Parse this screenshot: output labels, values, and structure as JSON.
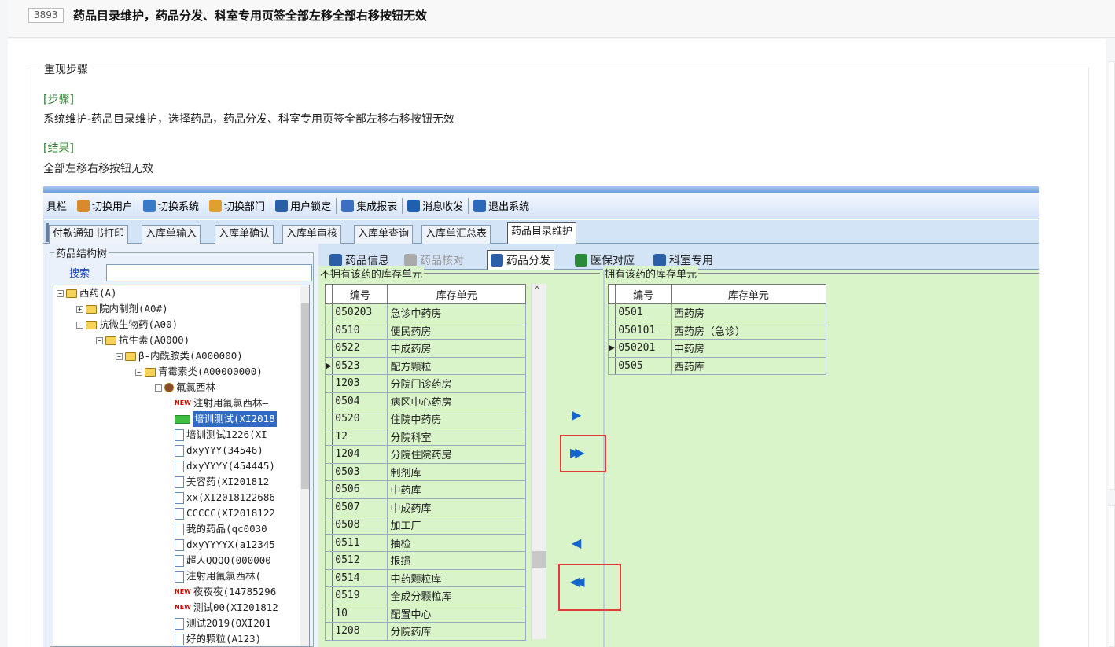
{
  "issue": {
    "id": "3893",
    "title": "药品目录维护，药品分发、科室专用页签全部左移全部右移按钮无效"
  },
  "section": {
    "legend": "重现步骤",
    "steps_label": "[步骤]",
    "steps_text": "系统维护-药品目录维护，选择药品，药品分发、科室专用页签全部左移右移按钮无效",
    "result_label": "[结果]",
    "result_text": "全部左移右移按钮无效"
  },
  "toolbar": {
    "items": [
      {
        "label": "具栏",
        "icon": "none"
      },
      {
        "label": "切换用户",
        "icon": "users-icon"
      },
      {
        "label": "切换系统",
        "icon": "switch-system-icon"
      },
      {
        "label": "切换部门",
        "icon": "department-icon"
      },
      {
        "label": "用户锁定",
        "icon": "user-lock-icon"
      },
      {
        "label": "集成报表",
        "icon": "report-icon"
      },
      {
        "label": "消息收发",
        "icon": "info-icon"
      },
      {
        "label": "退出系统",
        "icon": "exit-icon"
      }
    ]
  },
  "tabs": [
    "付款通知书打印",
    "入库单输入",
    "入库单确认",
    "入库单审核",
    "入库单查询",
    "入库单汇总表",
    "药品目录维护"
  ],
  "tree": {
    "legend": "药品结构树",
    "search_label": "搜索",
    "nodes": [
      {
        "label": "西药(A)",
        "indent": 0,
        "type": "folder",
        "exp": "-"
      },
      {
        "label": "院内制剂(A0#)",
        "indent": 1,
        "type": "folder",
        "exp": "+"
      },
      {
        "label": "抗微生物药(A00)",
        "indent": 1,
        "type": "folder",
        "exp": "-"
      },
      {
        "label": "抗生素(A0000)",
        "indent": 2,
        "type": "folder",
        "exp": "-"
      },
      {
        "label": "β-内酰胺类(A000000)",
        "indent": 3,
        "type": "folder",
        "exp": "-"
      },
      {
        "label": "青霉素类(A00000000)",
        "indent": 4,
        "type": "folder",
        "exp": "-"
      },
      {
        "label": "氟氯西林",
        "indent": 5,
        "type": "drug",
        "exp": "-"
      },
      {
        "label": "注射用氟氯西林—",
        "indent": 6,
        "type": "new"
      },
      {
        "label": "培训测试(XI2018",
        "indent": 6,
        "type": "selected"
      },
      {
        "label": "培训测试1226(XI",
        "indent": 6,
        "type": "doc"
      },
      {
        "label": "dxyYYY(34546)",
        "indent": 6,
        "type": "doc"
      },
      {
        "label": "dxyYYYY(454445)",
        "indent": 6,
        "type": "doc"
      },
      {
        "label": "美容药(XI201812",
        "indent": 6,
        "type": "doc"
      },
      {
        "label": "xx(XI2018122686",
        "indent": 6,
        "type": "doc"
      },
      {
        "label": "CCCCC(XI2018122",
        "indent": 6,
        "type": "doc"
      },
      {
        "label": "我的药品(qc0030",
        "indent": 6,
        "type": "doc"
      },
      {
        "label": "dxyYYYYX(a12345",
        "indent": 6,
        "type": "doc"
      },
      {
        "label": "超人QQQQ(000000",
        "indent": 6,
        "type": "doc"
      },
      {
        "label": "注射用氟氯西林(",
        "indent": 6,
        "type": "doc"
      },
      {
        "label": "夜夜夜(14785296",
        "indent": 6,
        "type": "new"
      },
      {
        "label": "测试00(XI201812",
        "indent": 6,
        "type": "new"
      },
      {
        "label": "测试2019(OXI201",
        "indent": 6,
        "type": "doc"
      },
      {
        "label": "好的颗粒(A123)",
        "indent": 6,
        "type": "doc"
      }
    ]
  },
  "subtabs": [
    {
      "label": "药品信息",
      "state": "normal"
    },
    {
      "label": "药品核对",
      "state": "disabled"
    },
    {
      "label": "药品分发",
      "state": "active"
    },
    {
      "label": "医保对应",
      "state": "normal"
    },
    {
      "label": "科室专用",
      "state": "normal"
    }
  ],
  "left_group": {
    "title": "不拥有该药的库存单元",
    "headers": [
      "编号",
      "库存单元"
    ],
    "current_row": 3,
    "rows": [
      [
        "050203",
        "急诊中药房"
      ],
      [
        "0510",
        "便民药房"
      ],
      [
        "0522",
        "中成药房"
      ],
      [
        "0523",
        "配方颗粒"
      ],
      [
        "1203",
        "分院门诊药房"
      ],
      [
        "0504",
        "病区中心药房"
      ],
      [
        "0520",
        "住院中药房"
      ],
      [
        "12",
        "分院科室"
      ],
      [
        "1204",
        "分院住院药房"
      ],
      [
        "0503",
        "制剂库"
      ],
      [
        "0506",
        "中药库"
      ],
      [
        "0507",
        "中成药库"
      ],
      [
        "0508",
        "加工厂"
      ],
      [
        "0511",
        "抽检"
      ],
      [
        "0512",
        "报损"
      ],
      [
        "0514",
        "中药颗粒库"
      ],
      [
        "0519",
        "全成分颗粒库"
      ],
      [
        "10",
        "配置中心"
      ],
      [
        "1208",
        "分院药库"
      ]
    ]
  },
  "right_group": {
    "title": "拥有该药的库存单元",
    "headers": [
      "编号",
      "库存单元"
    ],
    "current_row": 2,
    "rows": [
      [
        "0501",
        "西药房"
      ],
      [
        "050101",
        "西药房（急诊）"
      ],
      [
        "050201",
        "中药房"
      ],
      [
        "0505",
        "西药库"
      ]
    ]
  },
  "buttons": {
    "move_right": "▶",
    "move_all_right": "▶▶",
    "move_left": "◀",
    "move_all_left": "◀◀"
  }
}
